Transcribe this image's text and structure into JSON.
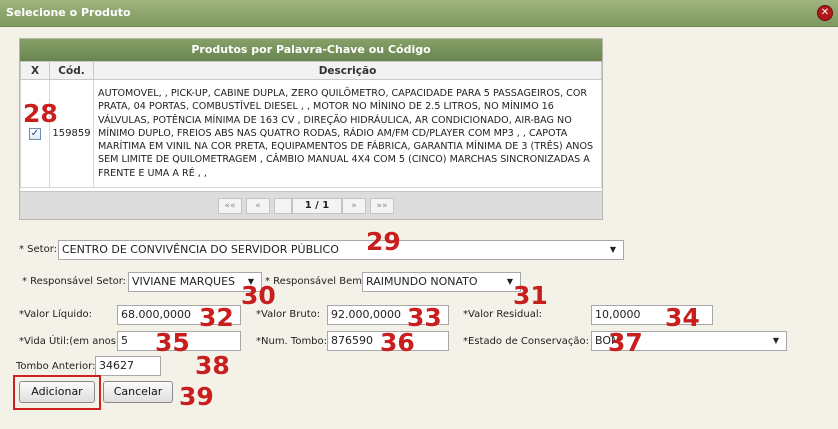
{
  "window": {
    "title": "Selecione o Produto",
    "close_icon": "close-icon"
  },
  "grid": {
    "header": "Produtos por Palavra-Chave ou Código",
    "columns": [
      "X",
      "Cód.",
      "Descrição"
    ],
    "rows": [
      {
        "checked": true,
        "code": "159859",
        "description": "AUTOMOVEL, , PICK-UP, CABINE DUPLA, ZERO QUILÔMETRO, CAPACIDADE PARA 5 PASSAGEIROS, COR PRATA, 04 PORTAS, COMBUSTÍVEL DIESEL , , MOTOR NO MÍNINO DE 2.5 LITROS, NO MÍNIMO 16 VÁLVULAS, POTÊNCIA MÍNIMA DE 163 CV , DIREÇÃO HIDRÁULICA, AR CONDICIONADO, AIR-BAG NO MÍNIMO DUPLO, FREIOS ABS NAS QUATRO RODAS, RÁDIO AM/FM CD/PLAYER COM MP3 , , CAPOTA MARÍTIMA EM VINIL NA COR PRETA, EQUIPAMENTOS DE FÁBRICA, GARANTIA MÍNIMA DE 3 (TRÊS) ANOS SEM LIMITE DE QUILOMETRAGEM , CÂMBIO MANUAL 4X4 COM 5 (CINCO) MARCHAS SINCRONIZADAS A FRENTE E UMA A RÉ , ,"
      }
    ],
    "pager": {
      "first": "««",
      "prev": "«",
      "info": "1 / 1",
      "next": "»",
      "last": "»»"
    }
  },
  "form": {
    "setor": {
      "label": "* Setor:",
      "value": "CENTRO DE CONVIVÊNCIA DO SERVIDOR PÚBLICO"
    },
    "responsavel_setor": {
      "label": "* Responsável Setor:",
      "value": "VIVIANE MARQUES"
    },
    "responsavel_bem": {
      "label": "* Responsável Bem",
      "value": "RAIMUNDO NONATO"
    },
    "valor_liquido": {
      "label": "*Valor Líquido:",
      "value": "68.000,0000"
    },
    "valor_bruto": {
      "label": "*Valor Bruto:",
      "value": "92.000,0000"
    },
    "valor_residual": {
      "label": "*Valor Residual:",
      "value": "10,0000"
    },
    "vida_util": {
      "label": "*Vida Útil:(em anos)",
      "value": "5"
    },
    "num_tombo": {
      "label": "*Num. Tombo:",
      "value": "876590"
    },
    "estado": {
      "label": "*Estado de Conservação:",
      "value": "BOM"
    },
    "tombo_anterior": {
      "label": "Tombo Anterior:",
      "value": "34627"
    }
  },
  "buttons": {
    "add": "Adicionar",
    "cancel": "Cancelar"
  },
  "markers": [
    "28",
    "29",
    "30",
    "31",
    "32",
    "33",
    "34",
    "35",
    "36",
    "37",
    "38",
    "39"
  ],
  "colors": {
    "title_bar": "#8aa56b",
    "grid_header": "#7a9460",
    "marker_red": "#c81e1e"
  }
}
